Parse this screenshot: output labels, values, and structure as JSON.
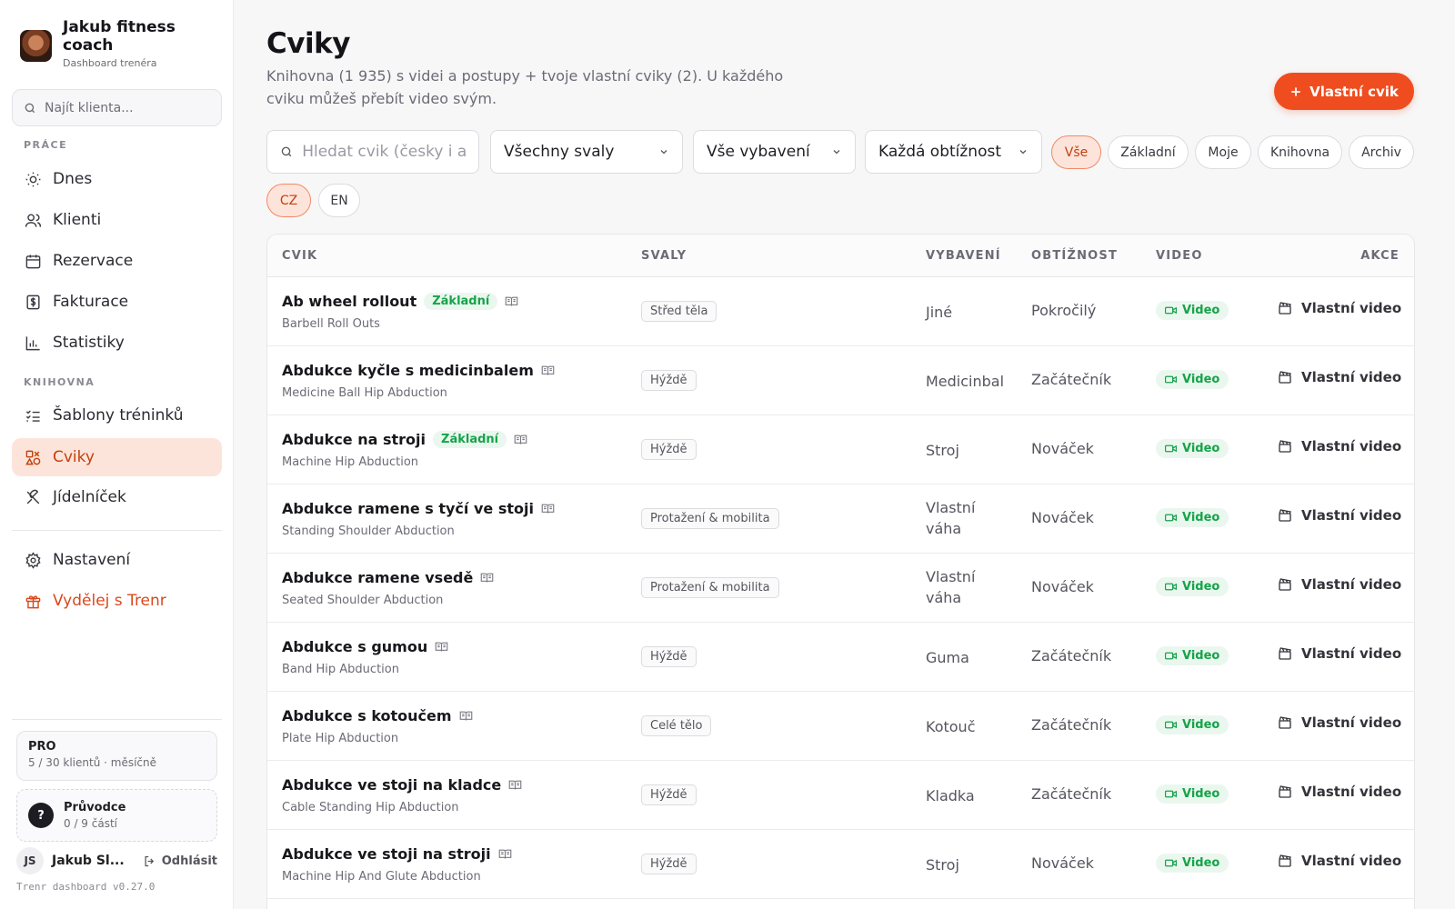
{
  "brand": {
    "name": "Jakub fitness coach",
    "subtitle": "Dashboard trenéra"
  },
  "client_search": {
    "placeholder": "Najít klienta..."
  },
  "nav": {
    "section_work": "PRÁCE",
    "section_library": "KNIHOVNA",
    "items": [
      {
        "label": "Dnes",
        "icon": "sun-icon"
      },
      {
        "label": "Klienti",
        "icon": "users-icon"
      },
      {
        "label": "Rezervace",
        "icon": "calendar-icon"
      },
      {
        "label": "Fakturace",
        "icon": "dollar-icon"
      },
      {
        "label": "Statistiky",
        "icon": "bar-chart-icon"
      },
      {
        "label": "Šablony tréninků",
        "icon": "list-check-icon"
      },
      {
        "label": "Cviky",
        "icon": "shapes-icon",
        "active": true
      },
      {
        "label": "Jídelníček",
        "icon": "utensils-icon"
      },
      {
        "label": "Nastavení",
        "icon": "gear-icon"
      },
      {
        "label": "Vydělej s Trenr",
        "icon": "gift-icon",
        "accent": true
      }
    ]
  },
  "plan": {
    "title": "PRO",
    "detail": "5 / 30 klientů · měsíčně"
  },
  "guide": {
    "icon_text": "?",
    "title": "Průvodce",
    "progress": "0 / 9 částí"
  },
  "user": {
    "initials": "JS",
    "name": "Jakub Sl...",
    "logout_label": "Odhlásit"
  },
  "version": "Trenr dashboard v0.27.0",
  "page": {
    "title": "Cviky",
    "description": "Knihovna (1 935) s videi a postupy + tvoje vlastní cviky (2). U každého cviku můžeš přebít video svým.",
    "add_button": "Vlastní cvik"
  },
  "filters": {
    "search_placeholder": "Hledat cvik (česky i ang",
    "muscles": "Všechny svaly",
    "equipment": "Vše vybavení",
    "difficulty": "Každá obtížnost",
    "chips": [
      "Vše",
      "Základní",
      "Moje",
      "Knihovna",
      "Archiv"
    ],
    "active_chip": "Vše",
    "languages": [
      "CZ",
      "EN"
    ],
    "active_language": "CZ"
  },
  "table": {
    "headers": {
      "exercise": "CVIK",
      "muscles": "SVALY",
      "equipment": "VYBAVENÍ",
      "difficulty": "OBTÍŽNOST",
      "video": "VIDEO",
      "actions": "AKCE"
    },
    "video_label": "Video",
    "own_video_label": "Vlastní video",
    "basic_label": "Základní",
    "rows": [
      {
        "name": "Ab wheel rollout",
        "en": "Barbell Roll Outs",
        "basic": true,
        "muscle": "Střed těla",
        "equipment": "Jiné",
        "difficulty": "Pokročilý"
      },
      {
        "name": "Abdukce kyčle s medicinbalem",
        "en": "Medicine Ball Hip Abduction",
        "basic": false,
        "muscle": "Hýždě",
        "equipment": "Medicinbal",
        "difficulty": "Začátečník"
      },
      {
        "name": "Abdukce na stroji",
        "en": "Machine Hip Abduction",
        "basic": true,
        "muscle": "Hýždě",
        "equipment": "Stroj",
        "difficulty": "Nováček"
      },
      {
        "name": "Abdukce ramene s tyčí ve stoji",
        "en": "Standing Shoulder Abduction",
        "basic": false,
        "muscle": "Protažení & mobilita",
        "equipment": "Vlastní váha",
        "difficulty": "Nováček"
      },
      {
        "name": "Abdukce ramene vsedě",
        "en": "Seated Shoulder Abduction",
        "basic": false,
        "muscle": "Protažení & mobilita",
        "equipment": "Vlastní váha",
        "difficulty": "Nováček"
      },
      {
        "name": "Abdukce s gumou",
        "en": "Band Hip Abduction",
        "basic": false,
        "muscle": "Hýždě",
        "equipment": "Guma",
        "difficulty": "Začátečník"
      },
      {
        "name": "Abdukce s kotoučem",
        "en": "Plate Hip Abduction",
        "basic": false,
        "muscle": "Celé tělo",
        "equipment": "Kotouč",
        "difficulty": "Začátečník"
      },
      {
        "name": "Abdukce ve stoji na kladce",
        "en": "Cable Standing Hip Abduction",
        "basic": false,
        "muscle": "Hýždě",
        "equipment": "Kladka",
        "difficulty": "Začátečník"
      },
      {
        "name": "Abdukce ve stoji na stroji",
        "en": "Machine Hip And Glute Abduction",
        "basic": false,
        "muscle": "Hýždě",
        "equipment": "Stroj",
        "difficulty": "Nováček"
      }
    ]
  },
  "colors": {
    "accent": "#ef4d1f",
    "active_bg": "#fde4db",
    "success": "#16a34a"
  }
}
